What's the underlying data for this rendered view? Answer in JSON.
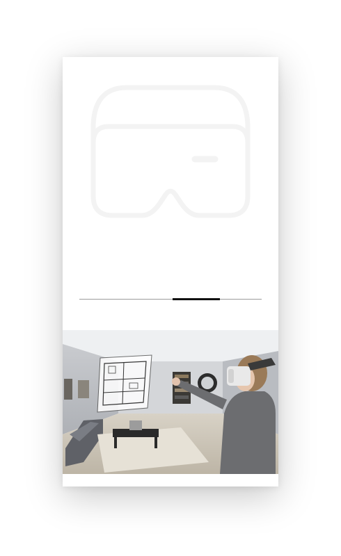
{
  "hero": {
    "icon": "vr-headset-icon"
  },
  "carousel": {
    "slide_count": 4,
    "active_index": 2,
    "progress_start": 0.51,
    "progress_end": 0.77
  },
  "photo": {
    "subject": "vr-user-room-photo",
    "accent": "#3a3a3a"
  }
}
